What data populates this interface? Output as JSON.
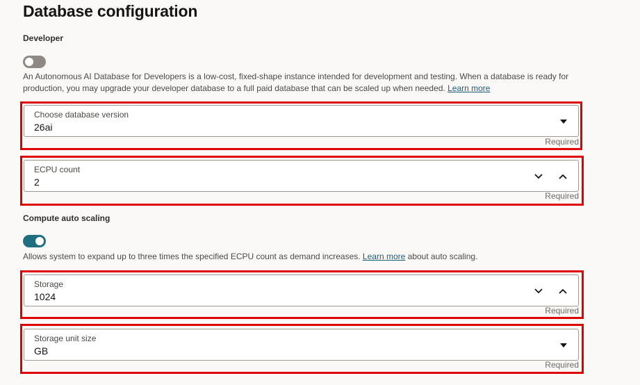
{
  "page": {
    "title": "Database configuration"
  },
  "developer": {
    "label": "Developer",
    "toggle_on": false,
    "description": "An Autonomous AI Database for Developers is a low-cost, fixed-shape instance intended for development and testing. When a database is ready for production, you may upgrade your developer database to a full paid database that can be scaled up when needed.",
    "learn_more": "Learn more"
  },
  "db_version": {
    "label": "Choose database version",
    "value": "26ai",
    "required": "Required",
    "icon": "caret-down-icon"
  },
  "ecpu": {
    "label": "ECPU count",
    "value": "2",
    "required": "Required",
    "icons": [
      "chevron-down-icon",
      "chevron-up-icon"
    ]
  },
  "autoscaling": {
    "label": "Compute auto scaling",
    "toggle_on": true,
    "description_before": "Allows system to expand up to three times the specified ECPU count as demand increases.",
    "learn_more": "Learn more",
    "description_after": "about auto scaling."
  },
  "storage": {
    "label": "Storage",
    "value": "1024",
    "required": "Required",
    "icons": [
      "chevron-down-icon",
      "chevron-up-icon"
    ]
  },
  "storage_unit": {
    "label": "Storage unit size",
    "value": "GB",
    "required": "Required",
    "icon": "caret-down-icon"
  },
  "colors": {
    "highlight": "#e00000",
    "toggle_on": "#1f6f80",
    "link": "#1f5b73"
  }
}
